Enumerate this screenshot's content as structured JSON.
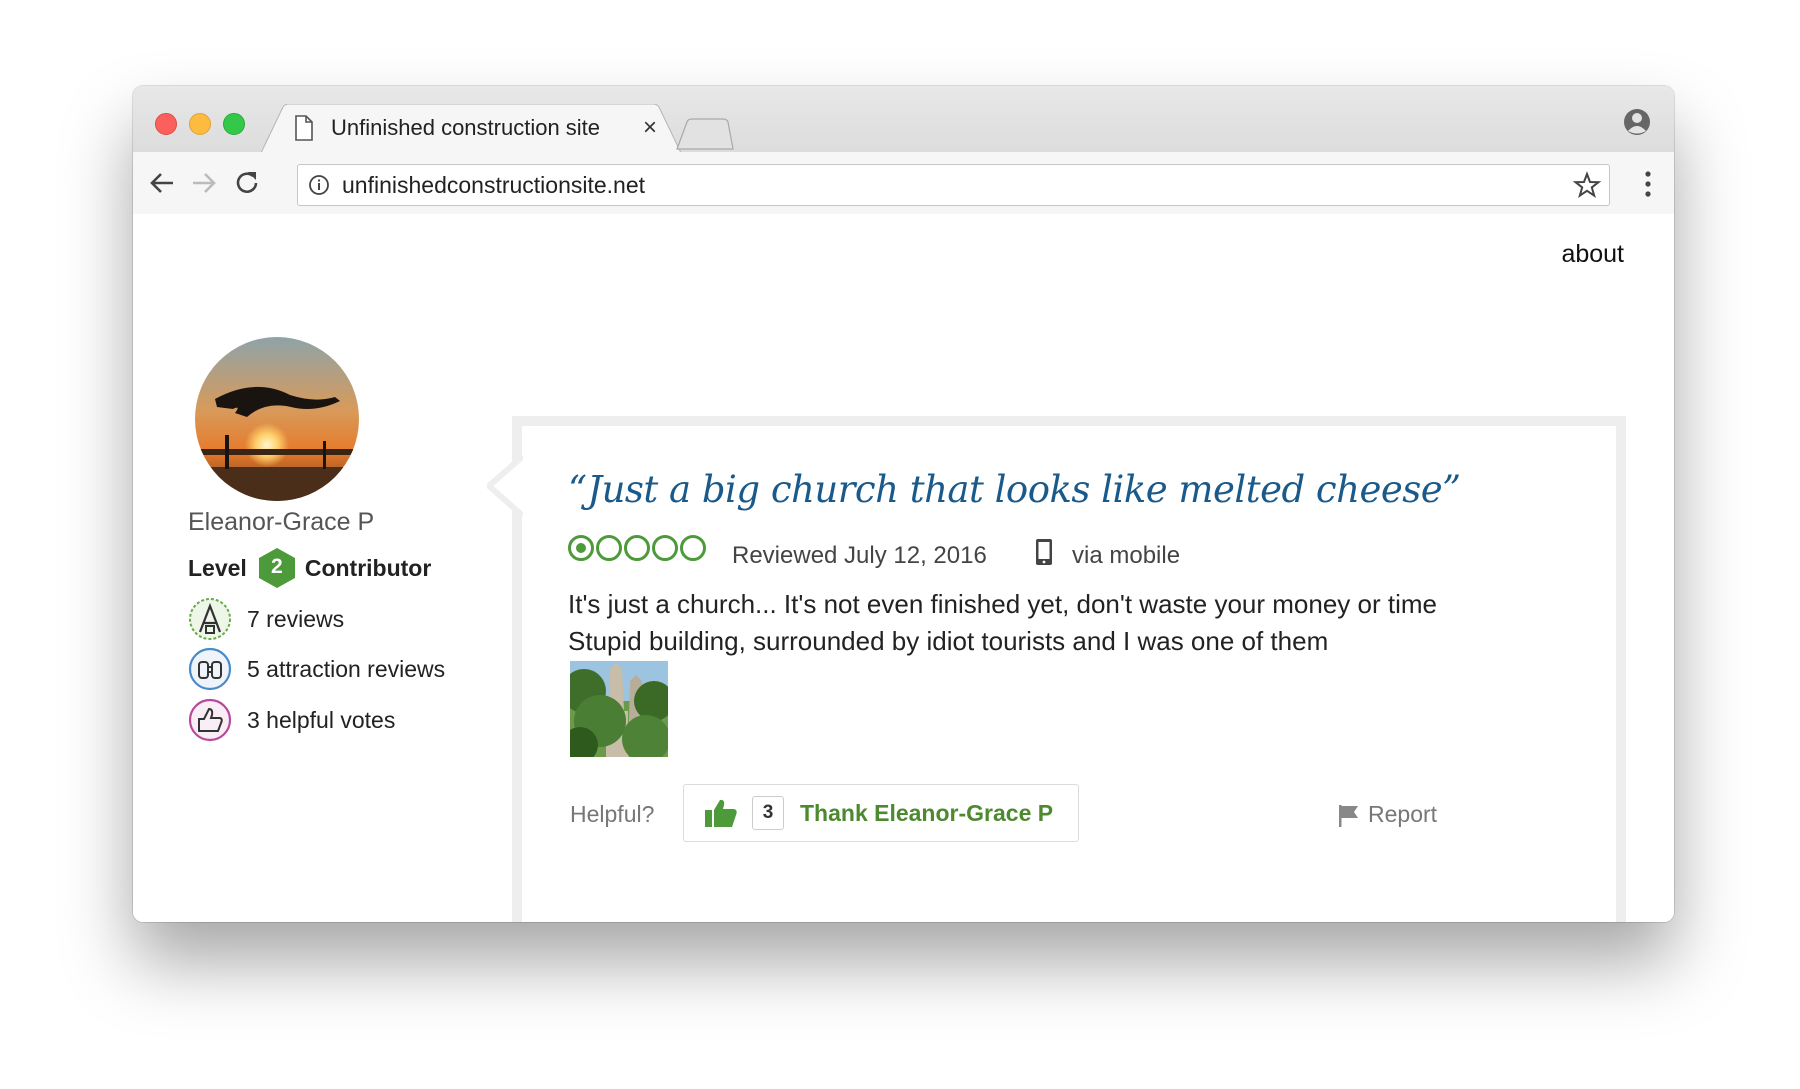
{
  "browser": {
    "tab_title": "Unfinished construction site",
    "url": "unfinishedconstructionsite.net"
  },
  "page": {
    "about_link": "about"
  },
  "user": {
    "name": "Eleanor-Grace P",
    "level_label": "Level",
    "level_number": "2",
    "level_suffix": "Contributor",
    "stats": [
      {
        "icon": "reviews-icon",
        "text": "7 reviews"
      },
      {
        "icon": "binoculars-icon",
        "text": "5 attraction reviews"
      },
      {
        "icon": "thumbs-up-icon",
        "text": "3 helpful votes"
      }
    ]
  },
  "review": {
    "title": "“Just a big church that looks like melted cheese”",
    "rating": 1,
    "rating_max": 5,
    "date": "Reviewed July 12, 2016",
    "via": "via mobile",
    "text": "It's just a church... It's not even finished yet, don't waste your money or time Stupid building, surrounded by idiot tourists and I was one of them",
    "helpful_label": "Helpful?",
    "thank_count": "3",
    "thank_label": "Thank Eleanor-Grace P",
    "report_label": "Report"
  },
  "colors": {
    "title_blue": "#1a5a8a",
    "rating_green": "#4d9a3a",
    "thank_green": "#4d8a2f"
  }
}
